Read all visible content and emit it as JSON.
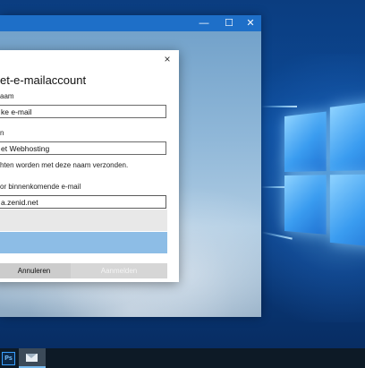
{
  "window": {
    "minimize_glyph": "—",
    "maximize_glyph": "☐",
    "close_glyph": "✕"
  },
  "dialog": {
    "close_glyph": "×",
    "title": "et-e-mailaccount",
    "name_label": "aam",
    "name_value": "ke e-mail",
    "display_label": "n",
    "display_value": "et Webhosting",
    "helper_text": "hten worden met deze naam verzonden.",
    "server_label": "or binnenkomende e-mail",
    "server_value": "a.zenid.net",
    "cancel_label": "Annuleren",
    "login_label": "Aanmelden"
  },
  "taskbar": {
    "photoshop_label": "Ps"
  },
  "colors": {
    "titlebar": "#1e6fc8",
    "suggestion_highlight": "#8dbde6",
    "taskbar": "#0d1a26"
  }
}
